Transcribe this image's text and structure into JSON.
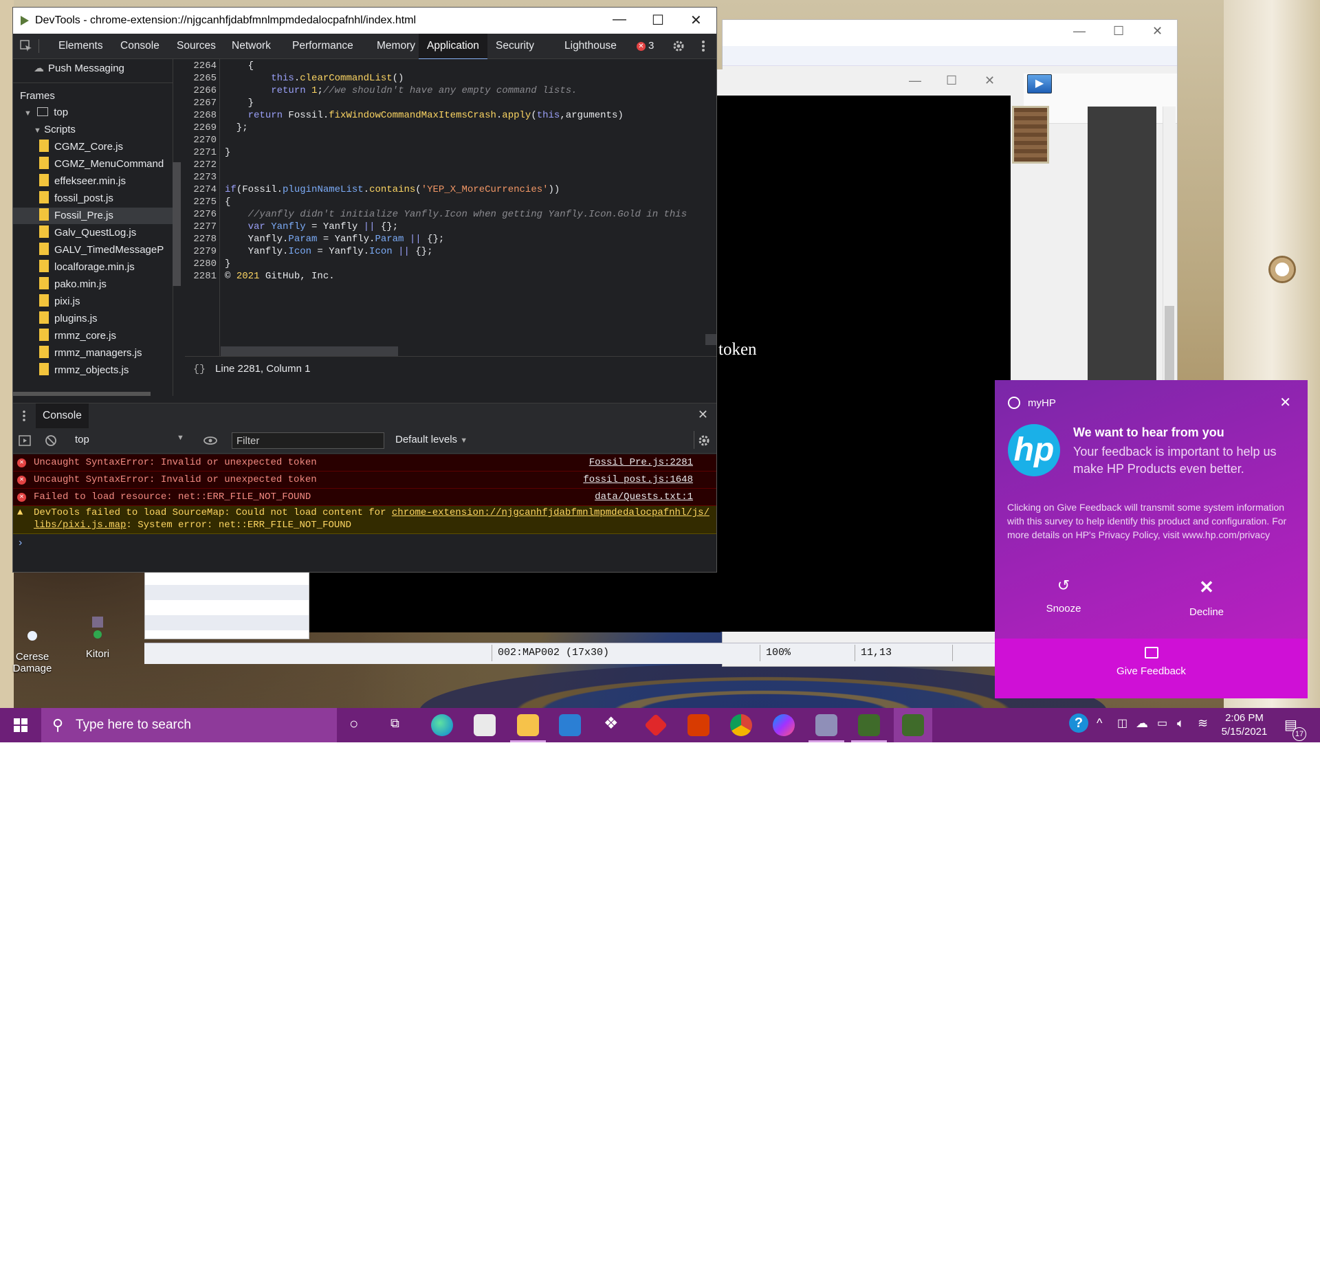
{
  "devtools": {
    "title": "DevTools - chrome-extension://njgcanhfjdabfmnlmpmdedalocpafnhl/index.html",
    "tabs": [
      "Elements",
      "Console",
      "Sources",
      "Network",
      "Performance",
      "Memory",
      "Application",
      "Security",
      "Lighthouse"
    ],
    "active_tab": "Application",
    "error_count": "3",
    "sidebar": {
      "push_messaging": "Push Messaging",
      "frames_header": "Frames",
      "top": "top",
      "scripts": "Scripts",
      "files": [
        "CGMZ_Core.js",
        "CGMZ_MenuCommand",
        "effekseer.min.js",
        "fossil_post.js",
        "Fossil_Pre.js",
        "Galv_QuestLog.js",
        "GALV_TimedMessageP",
        "localforage.min.js",
        "pako.min.js",
        "pixi.js",
        "plugins.js",
        "rmmz_core.js",
        "rmmz_managers.js",
        "rmmz_objects.js"
      ],
      "selected_file": "Fossil_Pre.js"
    },
    "editor": {
      "line_numbers": [
        "2264",
        "2265",
        "2266",
        "2267",
        "2268",
        "2269",
        "2270",
        "2271",
        "2272",
        "2273",
        "2274",
        "2275",
        "2276",
        "2277",
        "2278",
        "2279",
        "2280",
        "2281"
      ],
      "status": "Line 2281, Column 1",
      "brace": "{}"
    },
    "console": {
      "drawer_tab": "Console",
      "context": "top",
      "filter_placeholder": "Filter",
      "levels": "Default levels",
      "messages": [
        {
          "text": "Uncaught SyntaxError: Invalid or unexpected token",
          "source": "Fossil_Pre.js:2281"
        },
        {
          "text": "Uncaught SyntaxError: Invalid or unexpected token",
          "source": "fossil_post.js:1648"
        },
        {
          "text": "Failed to load resource: net::ERR_FILE_NOT_FOUND",
          "source": "data/Quests.txt:1"
        }
      ],
      "warning": {
        "prefix": "DevTools failed to load SourceMap: Could not load content for ",
        "link1": "chrome-extension://njgcanhfjdabfmnlmpmdedalocpafnhl/js/",
        "link2": "libs/pixi.js.map",
        "suffix": ": System error: net::ERR_FILE_NOT_FOUND"
      }
    }
  },
  "game": {
    "token_text": "token",
    "status": {
      "map": "002:MAP002 (17x30)",
      "zoom": "100%",
      "coords": "11,13"
    }
  },
  "desktop_icons": [
    {
      "label": "Cerese Damage"
    },
    {
      "label": "Kitori"
    }
  ],
  "toast": {
    "app": "myHP",
    "logo": "hp",
    "heading": "We want to hear from you",
    "subheading": "Your feedback is important to help us make HP Products even better.",
    "body": "Clicking on Give Feedback will transmit some system information with this survey to help identify this product and configuration. For more details on HP's Privacy Policy, visit www.hp.com/privacy",
    "snooze": "Snooze",
    "decline": "Decline",
    "give_feedback": "Give Feedback"
  },
  "taskbar": {
    "search_placeholder": "Type here to search",
    "time": "2:06 PM",
    "date": "5/15/2021",
    "notifications": "17"
  }
}
